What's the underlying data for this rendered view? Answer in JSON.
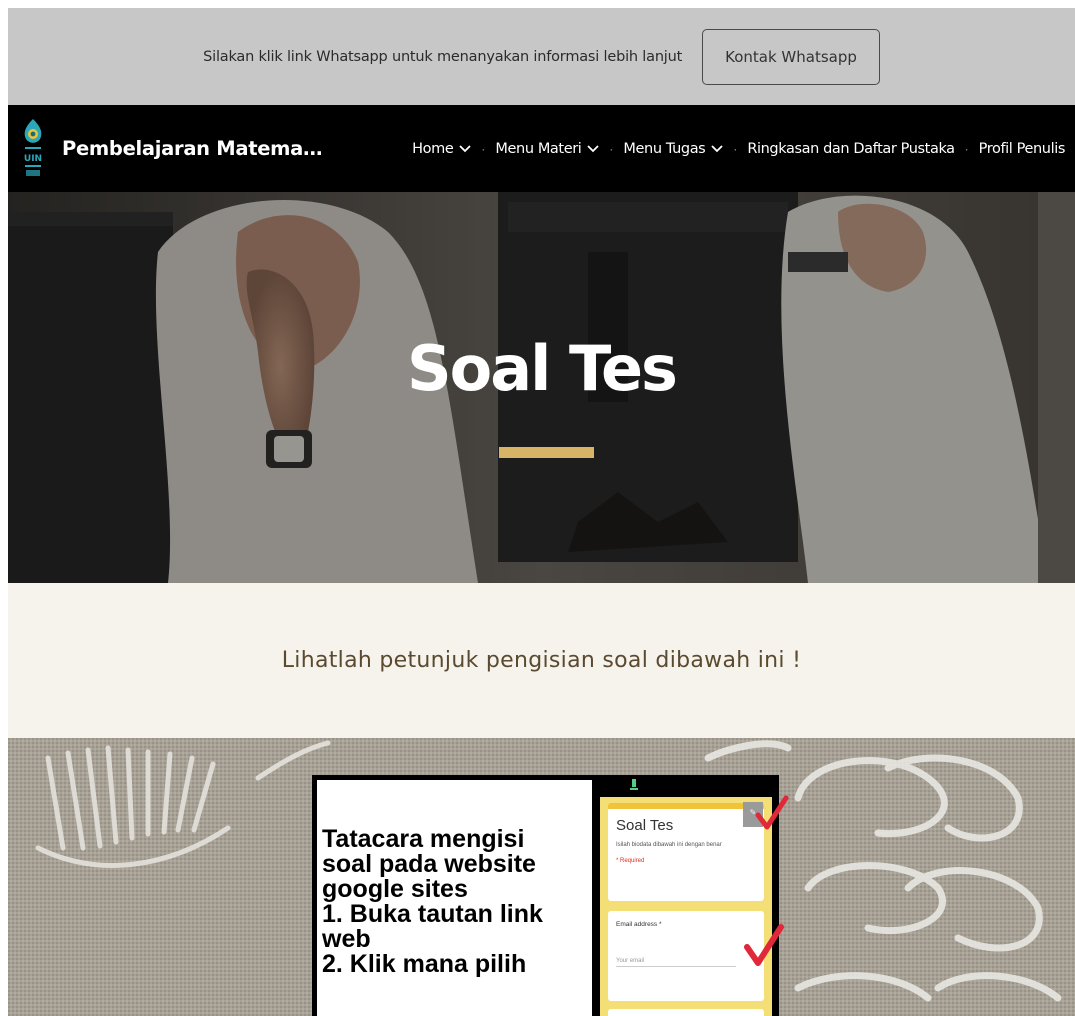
{
  "announcement": {
    "text": "Silakan klik link Whatsapp untuk menanyakan informasi lebih lanjut",
    "button_label": "Kontak Whatsapp"
  },
  "nav": {
    "site_title": "Pembelajaran Matema…",
    "logo_text": "UIN",
    "items": [
      {
        "label": "Home",
        "has_dropdown": true
      },
      {
        "label": "Menu Materi",
        "has_dropdown": true
      },
      {
        "label": "Menu Tugas",
        "has_dropdown": true
      },
      {
        "label": "Ringkasan dan Daftar Pustaka",
        "has_dropdown": false
      },
      {
        "label": "Profil Penulis",
        "has_dropdown": false
      }
    ],
    "separator": "·"
  },
  "hero": {
    "title": "Soal Tes",
    "underline_color": "#d7b466"
  },
  "instruction": {
    "text": "Lihatlah petunjuk pengisian soal dibawah ini !"
  },
  "tutorial_image": {
    "lines": [
      "Tatacara mengisi",
      "soal pada website",
      "google sites",
      "1. Buka tautan link",
      "web",
      "2. Klik mana pilih"
    ],
    "form": {
      "title": "Soal Tes",
      "description": "Isilah biodata dibawah ini dengan benar",
      "required_note": "* Required",
      "question_label": "Email address *",
      "input_placeholder": "Your email"
    }
  },
  "colors": {
    "announce_bg": "#c7c7c7",
    "nav_bg": "#000000",
    "accent": "#d7b466",
    "instruction_bg": "#f6f3ec",
    "form_bg": "#f4df76"
  }
}
